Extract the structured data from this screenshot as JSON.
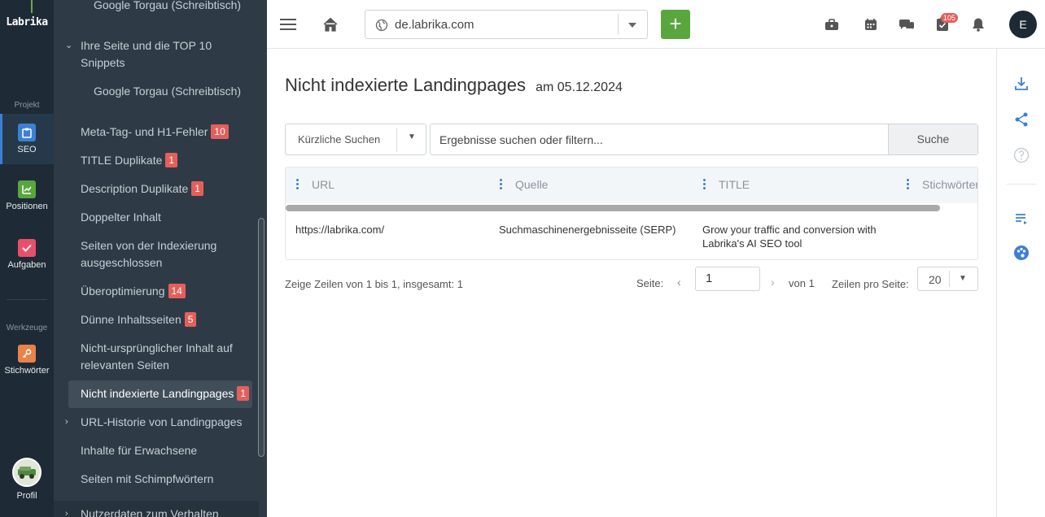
{
  "rail": {
    "logo": "Labrika",
    "section_projekt": "Projekt",
    "section_werkzeuge": "Werkzeuge",
    "items": {
      "seo": "SEO",
      "positionen": "Positionen",
      "aufgaben": "Aufgaben",
      "stichwoerter": "Stichwörter",
      "profil": "Profil"
    },
    "colors": {
      "seo": "#3c80d4",
      "positionen": "#5aa63e",
      "aufgaben": "#e8506a",
      "stichwoerter": "#e8834a"
    }
  },
  "sidebar": {
    "top_item": "Google Torgau (Schreibtisch)",
    "top10_group": "Ihre Seite und die TOP 10 Snippets",
    "top10_sub": "Google Torgau (Schreibtisch)",
    "items": [
      {
        "label": "Meta-Tag- und H1-Fehler",
        "badge": "10"
      },
      {
        "label": "TITLE Duplikate",
        "badge": "1"
      },
      {
        "label": "Description Duplikate",
        "badge": "1"
      },
      {
        "label": "Doppelter Inhalt",
        "badge": ""
      },
      {
        "label": "Seiten von der Indexierung ausgeschlossen",
        "badge": ""
      },
      {
        "label": "Überoptimierung",
        "badge": "14"
      },
      {
        "label": "Dünne Inhaltsseiten",
        "badge": "5"
      },
      {
        "label": "Nicht-ursprünglicher Inhalt auf relevanten Seiten",
        "badge": ""
      },
      {
        "label": "Nicht indexierte Landingpages",
        "badge": "1"
      },
      {
        "label": "URL-Historie von Landingpages",
        "badge": ""
      },
      {
        "label": "Inhalte für Erwachsene",
        "badge": ""
      },
      {
        "label": "Seiten mit Schimpfwörtern",
        "badge": ""
      },
      {
        "label": "Nutzerdaten zum Verhalten",
        "badge": ""
      }
    ]
  },
  "topbar": {
    "domain": "de.labrika.com",
    "add_label": "+",
    "notification_count": "105",
    "user_initial": "E"
  },
  "page": {
    "title": "Nicht indexierte Landingpages",
    "date": "am 05.12.2024"
  },
  "search": {
    "recent_label": "Kürzliche Suchen",
    "placeholder": "Ergebnisse suchen oder filtern...",
    "button": "Suche"
  },
  "table": {
    "columns": [
      "URL",
      "Quelle",
      "TITLE",
      "Stichwörter"
    ],
    "rows": [
      [
        "https://labrika.com/",
        "Suchmaschinenergebnisseite (SERP)",
        "Grow your traffic and conversion with Labrika's AI SEO tool",
        ""
      ]
    ]
  },
  "pager": {
    "summary": "Zeige Zeilen von 1 bis 1, insgesamt: 1",
    "seite_label": "Seite:",
    "page": "1",
    "of": "von 1",
    "rows_label": "Zeilen pro Seite:",
    "rows_value": "20"
  }
}
